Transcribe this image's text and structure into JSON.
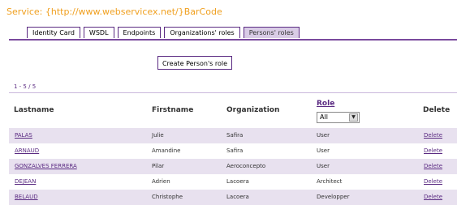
{
  "service": "Service: {http://www.webservicex.net/}BarCode",
  "tabs": [
    "Identity Card",
    "WSDL",
    "Endpoints",
    "Organizations' roles",
    "Persons' roles"
  ],
  "active_tab": "Persons' roles",
  "create_button": "Create Person's role",
  "pager": "1 - 5 / 5",
  "columns": {
    "lastname": "Lastname",
    "firstname": "Firstname",
    "organization": "Organization",
    "role": "Role",
    "delete": "Delete"
  },
  "role_filter": "All",
  "rows": [
    {
      "lastname": "PALAS",
      "firstname": "Julie",
      "organization": "Safira",
      "role": "User",
      "delete": "Delete"
    },
    {
      "lastname": "ARNAUD",
      "firstname": "Amandine",
      "organization": "Safira",
      "role": "User",
      "delete": "Delete"
    },
    {
      "lastname": "GONZALVES FERRERA",
      "firstname": "Pilar",
      "organization": "Aeroconcepto",
      "role": "User",
      "delete": "Delete"
    },
    {
      "lastname": "DEJEAN",
      "firstname": "Adrien",
      "organization": "Lacoera",
      "role": "Architect",
      "delete": "Delete"
    },
    {
      "lastname": "BELAUD",
      "firstname": "Christophe",
      "organization": "Lacoera",
      "role": "Developper",
      "delete": "Delete"
    }
  ],
  "colors": {
    "accent": "#5a2a82",
    "alt_row": "#e8e1ef",
    "service_text": "#f0a020"
  }
}
